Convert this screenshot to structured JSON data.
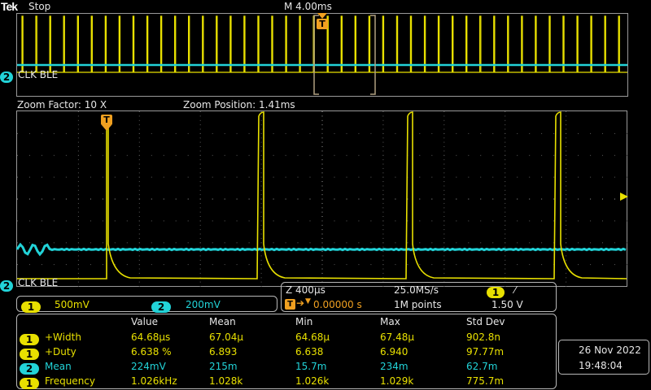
{
  "header": {
    "brand": "Tek",
    "run_state": "Stop",
    "main_timebase": "M 4.00ms",
    "trigger_marker": "T"
  },
  "overview": {
    "ch2_number": "2",
    "ch2_label": "CLK BLE"
  },
  "zoom_info": {
    "factor": "Zoom Factor: 10 X",
    "position": "Zoom Position: 1.41ms"
  },
  "zoom": {
    "ch2_number": "2",
    "ch2_label": "CLK BLE",
    "trigger_marker": "T"
  },
  "channel_scales": {
    "ch1_number": "1",
    "ch1_scale": "500mV",
    "ch2_number": "2",
    "ch2_scale": "200mV"
  },
  "acquisition": {
    "zoom_timebase": "Z 400µs",
    "sample_rate": "25.0MS/s",
    "trigger_source": "1",
    "trigger_slope": "⁄",
    "trigger_position": "0.00000 s",
    "record_length": "1M points",
    "trigger_level": "1.50 V"
  },
  "measurements": {
    "headers": [
      "Value",
      "Mean",
      "Min",
      "Max",
      "Std Dev"
    ],
    "rows": [
      {
        "channel": "1",
        "name": "+Width",
        "value": "64.68µs",
        "mean": "67.04µ",
        "min": "64.68µ",
        "max": "67.48µ",
        "stddev": "902.8n"
      },
      {
        "channel": "1",
        "name": "+Duty",
        "value": "6.638 %",
        "mean": "6.893",
        "min": "6.638",
        "max": "6.940",
        "stddev": "97.77m"
      },
      {
        "channel": "2",
        "name": "Mean",
        "value": "224mV",
        "mean": "215m",
        "min": "15.7m",
        "max": "234m",
        "stddev": "62.7m"
      },
      {
        "channel": "1",
        "name": "Frequency",
        "value": "1.026kHz",
        "mean": "1.028k",
        "min": "1.026k",
        "max": "1.029k",
        "stddev": "775.7m"
      }
    ]
  },
  "datetime": {
    "date": "26 Nov 2022",
    "time": "19:48:04"
  },
  "colors": {
    "ch1": "#e8e000",
    "ch2": "#22d3d8",
    "graticule": "#7a7a7a",
    "trigger": "#f0a020"
  }
}
